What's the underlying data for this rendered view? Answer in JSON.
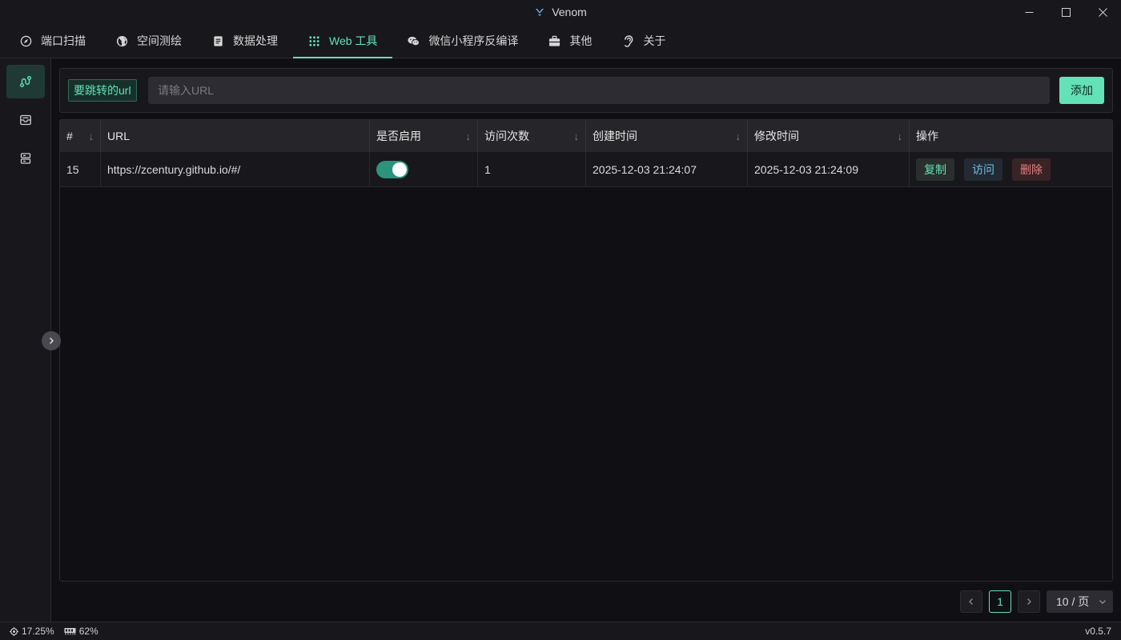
{
  "window": {
    "title": "Venom"
  },
  "menu": [
    {
      "label": "端口扫描",
      "icon": "compass-icon",
      "active": false
    },
    {
      "label": "空间测绘",
      "icon": "globe-icon",
      "active": false
    },
    {
      "label": "数据处理",
      "icon": "document-icon",
      "active": false
    },
    {
      "label": "Web 工具",
      "icon": "grid-dots-icon",
      "active": true
    },
    {
      "label": "微信小程序反编译",
      "icon": "wechat-icon",
      "active": false
    },
    {
      "label": "其他",
      "icon": "toolbox-icon",
      "active": false
    },
    {
      "label": "关于",
      "icon": "ear-icon",
      "active": false
    }
  ],
  "sidebar": {
    "items": [
      {
        "icon": "route-icon",
        "active": true
      },
      {
        "icon": "inbox-icon",
        "active": false
      },
      {
        "icon": "server-icon",
        "active": false
      }
    ]
  },
  "url_form": {
    "tag": "要跳转的url",
    "placeholder": "请输入URL",
    "value": "",
    "add_label": "添加"
  },
  "table": {
    "columns": [
      "#",
      "URL",
      "是否启用",
      "访问次数",
      "创建时间",
      "修改时间",
      "操作"
    ],
    "rows": [
      {
        "id": "15",
        "url": "https://zcentury.github.io/#/",
        "enabled": true,
        "visits": "1",
        "created": "2025-12-03 21:24:07",
        "modified": "2025-12-03 21:24:09",
        "actions": {
          "copy": "复制",
          "visit": "访问",
          "delete": "删除"
        }
      }
    ]
  },
  "pagination": {
    "current": "1",
    "page_size": "10 / 页"
  },
  "status": {
    "cpu": "17.25%",
    "memory": "62%",
    "version": "v0.5.7"
  },
  "colors": {
    "accent": "#63e2b7",
    "info": "#70c0e8",
    "danger": "#e88080",
    "background": "#101014"
  }
}
